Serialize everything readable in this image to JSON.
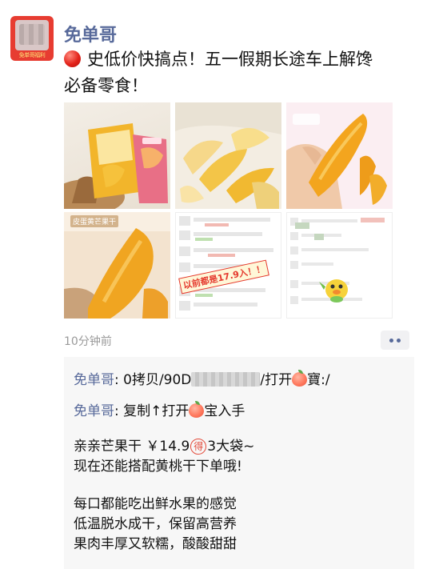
{
  "post": {
    "username": "免单哥",
    "avatar_tag": "免单哥福利",
    "title_line1": "史低价快搞点！五一假期长途车上解馋",
    "title_line2": "必备零食！",
    "grid_texts": {
      "c5_stamp": "以前都是17.9入！！",
      "c4_label": "皮蛋黄芒果干"
    },
    "time": "10分钟前"
  },
  "comments": [
    {
      "author": "免单哥",
      "before_blur": ": 0拷贝/90D",
      "after_blur": "/打开",
      "end": "寶:/"
    },
    {
      "author": "免单哥",
      "before": ": 复制↑打开",
      "after": "宝入手"
    }
  ],
  "body": {
    "line1_a": "亲亲芒果干 ￥14.9",
    "line1_circle": "得",
    "line1_b": "3大袋~",
    "line2": "现在还能搭配黄桃干下单哦!",
    "line3": "每口都能吃出鲜水果的感觉",
    "line4": "低温脱水成干，保留高营养",
    "line5": "果肉丰厚又软糯，酸酸甜甜"
  },
  "colors": {
    "name_blue": "#57699a",
    "comment_bg": "#f7f7f7",
    "time_gray": "#9a9a9a",
    "avatar_red": "#e73c31"
  },
  "icons": {
    "more": "more-dots-icon",
    "red_circle": "red-circle-emoji",
    "peach": "peach-emoji"
  }
}
